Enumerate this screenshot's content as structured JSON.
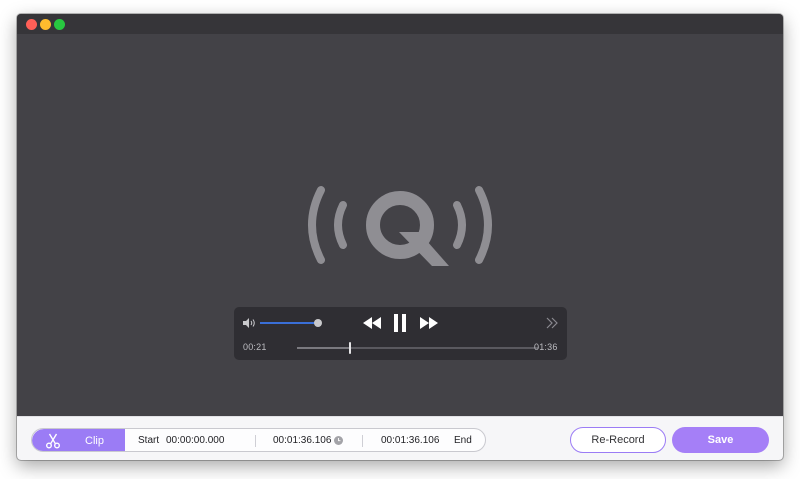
{
  "window": {
    "traffic_lights": [
      "close",
      "minimize",
      "maximize"
    ]
  },
  "preview": {
    "logo_icon": "audio-broadcast-q-logo"
  },
  "player": {
    "volume_icon": "speaker-icon",
    "volume_level": 0.9,
    "rewind_icon": "rewind-icon",
    "pause_icon": "pause-icon",
    "forward_icon": "fast-forward-icon",
    "expand_icon": "double-chevron-right-icon",
    "current_time": "00:21",
    "total_time": "01:36",
    "progress": 0.22
  },
  "clip_bar": {
    "clip_label": "Clip",
    "start_label": "Start",
    "start_time": "00:00:00.000",
    "duration": "00:01:36.106",
    "end_time": "00:01:36.106",
    "end_label": "End"
  },
  "actions": {
    "rerecord_label": "Re-Record",
    "save_label": "Save"
  },
  "colors": {
    "accent": "#a57ff7",
    "volume": "#3a6fd8",
    "background": "#434247"
  }
}
